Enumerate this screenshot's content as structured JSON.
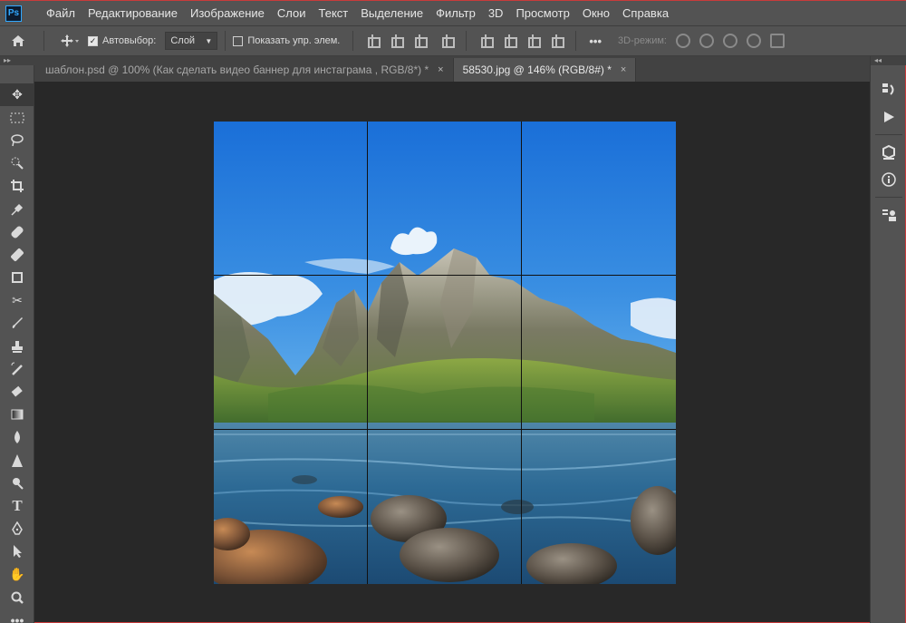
{
  "app": {
    "logo": "Ps"
  },
  "menu": [
    "Файл",
    "Редактирование",
    "Изображение",
    "Слои",
    "Текст",
    "Выделение",
    "Фильтр",
    "3D",
    "Просмотр",
    "Окно",
    "Справка"
  ],
  "options": {
    "autoselect_label": "Автовыбор:",
    "autoselect_checked": true,
    "layer_select_value": "Слой",
    "show_transform_label": "Показать упр. элем.",
    "show_transform_checked": false,
    "more": "•••",
    "mode3d_label": "3D-режим:"
  },
  "tabs": [
    {
      "label": "шаблон.psd @ 100% (Как сделать видео баннер для инстаграма , RGB/8*) *",
      "active": false,
      "close": "×"
    },
    {
      "label": "58530.jpg @ 146% (RGB/8#) *",
      "active": true,
      "close": "×"
    }
  ],
  "tools": [
    "move-tool",
    "marquee-tool",
    "lasso-tool",
    "quick-select-tool",
    "crop-tool",
    "eyedropper-tool",
    "healing-brush-tool",
    "patch-tool",
    "frame-tool",
    "content-aware-move-tool",
    "brush-tool",
    "clone-stamp-tool",
    "history-brush-tool",
    "eraser-tool",
    "gradient-tool",
    "blur-tool",
    "sharpen-tool",
    "dodge-tool",
    "type-tool",
    "pen-tool",
    "path-select-tool",
    "hand-tool",
    "zoom-tool",
    "more-tools"
  ],
  "right_panel": [
    "history-icon",
    "actions-play-icon",
    "3d-icon",
    "info-icon",
    "properties-icon"
  ],
  "colors": {
    "sky_top": "#1a6fd8",
    "sky_bottom": "#4ea4ea",
    "water": "#2d6a95",
    "mountain": "#6d7260"
  }
}
